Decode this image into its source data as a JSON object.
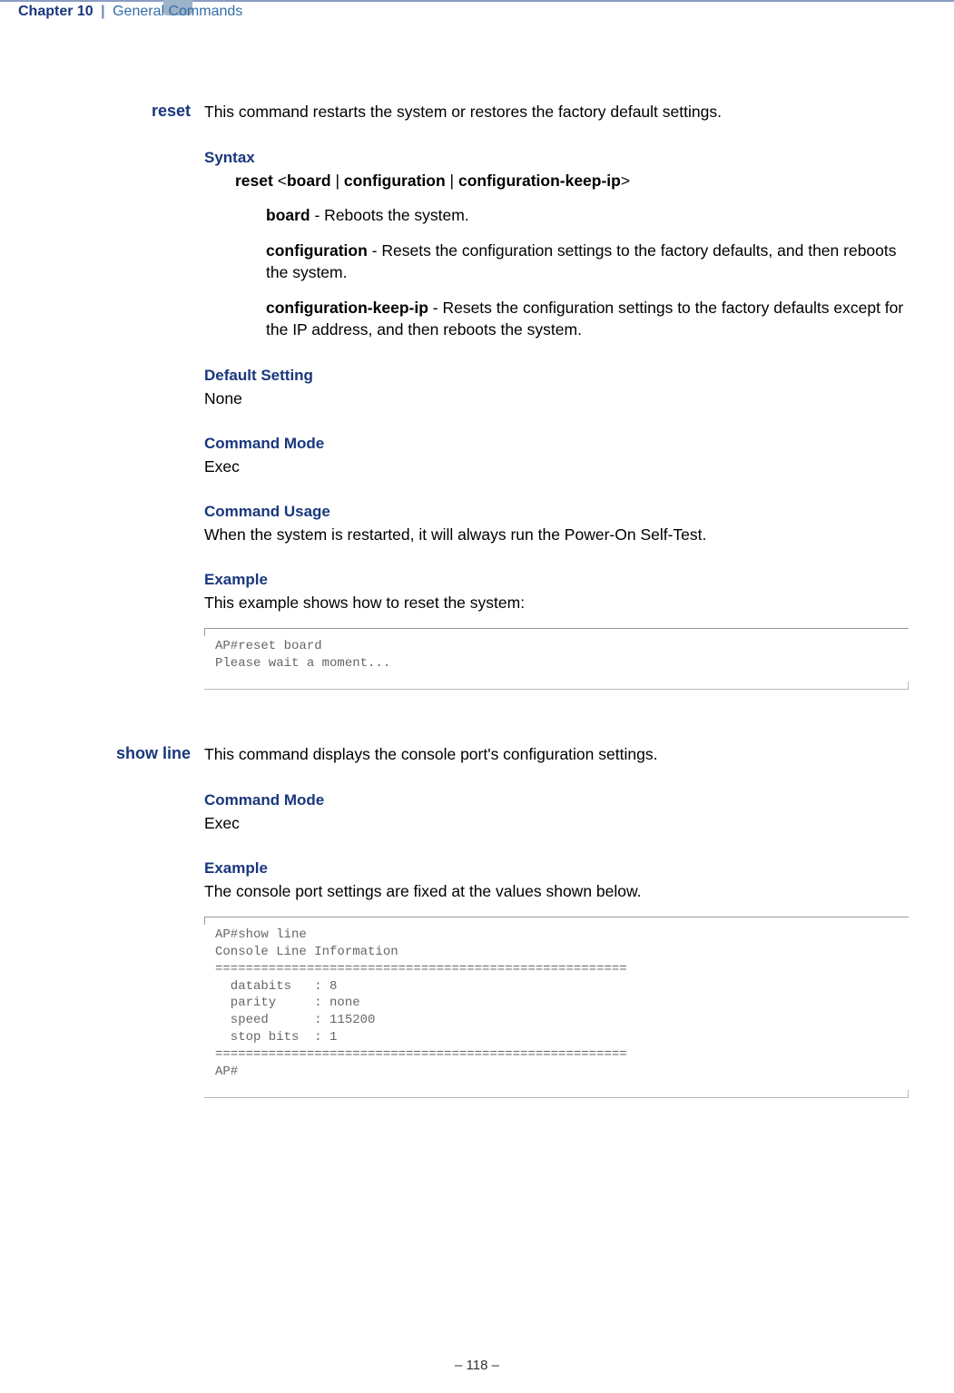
{
  "header": {
    "chapter": "Chapter 10",
    "separator": "|",
    "title": "General Commands"
  },
  "commands": [
    {
      "name": "reset",
      "description": "This command restarts the system or restores the factory default settings.",
      "syntax": {
        "title": "Syntax",
        "line_prefix": "reset",
        "line_open": "<",
        "p1": "board",
        "sep": "|",
        "p2": "configuration",
        "p3": "configuration-keep-ip",
        "line_close": ">",
        "params": [
          {
            "kw": "board",
            "desc": " - Reboots the system."
          },
          {
            "kw": "configuration",
            "desc": " - Resets the configuration settings to the factory defaults, and then reboots the system."
          },
          {
            "kw": "configuration-keep-ip",
            "desc": " - Resets the configuration settings to the factory defaults except for the IP address, and then reboots the system."
          }
        ]
      },
      "sections": [
        {
          "title": "Default Setting",
          "body": "None"
        },
        {
          "title": "Command Mode",
          "body": "Exec"
        },
        {
          "title": "Command Usage",
          "body": "When the system is restarted, it will always run the Power-On Self-Test."
        },
        {
          "title": "Example",
          "body": "This example shows how to reset the system:"
        }
      ],
      "example_code": "AP#reset board\nPlease wait a moment..."
    },
    {
      "name": "show line",
      "description": "This command displays the console port's configuration settings.",
      "sections": [
        {
          "title": "Command Mode",
          "body": "Exec"
        },
        {
          "title": "Example",
          "body": "The console port settings are fixed at the values shown below."
        }
      ],
      "example_code": "AP#show line\nConsole Line Information\n======================================================\n  databits   : 8\n  parity     : none\n  speed      : 115200\n  stop bits  : 1\n======================================================\nAP#"
    }
  ],
  "footer": {
    "page_number": "–  118  –"
  }
}
